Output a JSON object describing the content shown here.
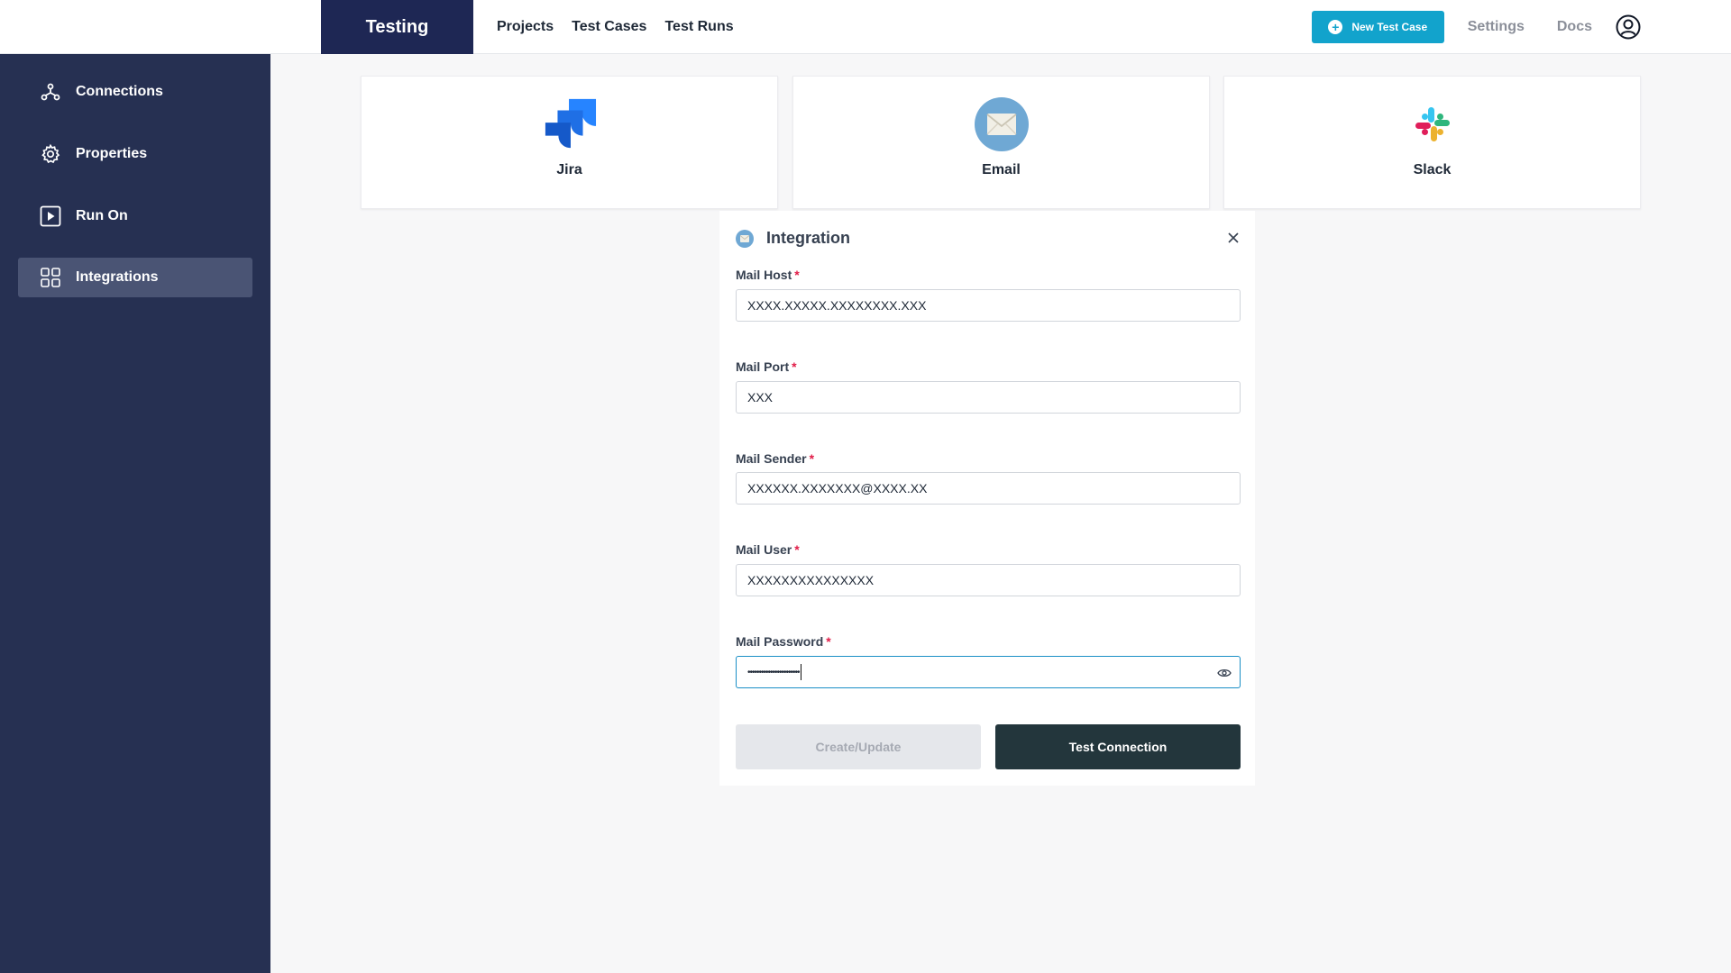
{
  "topbar": {
    "brand": "Testing",
    "nav": [
      "Projects",
      "Test Cases",
      "Test Runs"
    ],
    "new_button": "New Test Case",
    "settings": "Settings",
    "docs": "Docs"
  },
  "sidebar": {
    "items": [
      {
        "label": "Connections",
        "icon": "connections-icon"
      },
      {
        "label": "Properties",
        "icon": "gear-icon"
      },
      {
        "label": "Run On",
        "icon": "play-icon"
      },
      {
        "label": "Integrations",
        "icon": "grid-icon",
        "active": true
      }
    ]
  },
  "integrations": [
    {
      "name": "Jira",
      "icon": "jira-logo"
    },
    {
      "name": "Email",
      "icon": "email-logo"
    },
    {
      "name": "Slack",
      "icon": "slack-logo"
    }
  ],
  "panel": {
    "title": "Integration",
    "fields": [
      {
        "label": "Mail Host",
        "value": "XXXX.XXXXX.XXXXXXXX.XXX"
      },
      {
        "label": "Mail Port",
        "value": "XXX"
      },
      {
        "label": "Mail Sender",
        "value": "XXXXXX.XXXXXXX@XXXX.XX"
      },
      {
        "label": "Mail User",
        "value": "XXXXXXXXXXXXXXX"
      },
      {
        "label": "Mail Password",
        "value": "•••••••••••••••••••••••"
      }
    ],
    "required_mark": "*",
    "create_button": "Create/Update",
    "test_button": "Test Connection"
  },
  "colors": {
    "brand": "#1e2754",
    "sidebar": "#263052",
    "accent": "#12a3cc",
    "primary_button": "#23363c"
  }
}
